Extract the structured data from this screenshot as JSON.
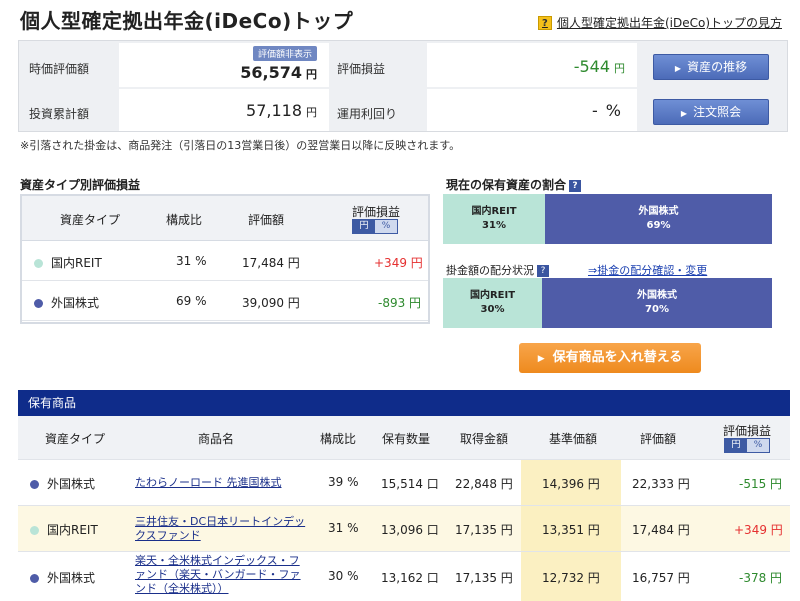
{
  "page": {
    "title": "個人型確定拠出年金(iDeCo)トップ",
    "help_link": "個人型確定拠出年金(iDeCo)トップの見方",
    "help_icon": "?"
  },
  "summary": {
    "valuation_label": "時価評価額",
    "valuation_badge": "評価額非表示",
    "valuation_value": "56,574",
    "yen": "円",
    "invest_label": "投資累計額",
    "invest_value": "57,118",
    "gain_label": "評価損益",
    "gain_value": "-544",
    "yield_label": "運用利回り",
    "yield_value": "-",
    "yield_unit": "%",
    "btn_trend": "資産の推移",
    "btn_orders": "注文照会",
    "arrow": "▶"
  },
  "note": "※引落された掛金は、商品発注（引落日の13営業日後）の翌営業日以降に反映されます。",
  "asset_type": {
    "title": "資産タイプ別評価損益",
    "headers": {
      "type": "資産タイプ",
      "ratio": "構成比",
      "value": "評価額",
      "gain": "評価損益",
      "toggle_yen": "円",
      "toggle_pct": "%"
    },
    "rows": [
      {
        "name": "国内REIT",
        "ratio": "31 %",
        "value": "17,484 円",
        "gain": "+349 円",
        "color": "#b9e4d7"
      },
      {
        "name": "外国株式",
        "ratio": "69 %",
        "value": "39,090 円",
        "gain": "-893 円",
        "color": "#4f5ca8"
      }
    ]
  },
  "allocation": {
    "current_title": "現在の保有資産の割合",
    "current": [
      {
        "name": "国内REIT",
        "pct": "31%",
        "share": 0.31
      },
      {
        "name": "外国株式",
        "pct": "69%",
        "share": 0.69
      }
    ],
    "contrib_title": "掛金額の配分状況",
    "contrib_link": "⇒掛金の配分確認・変更",
    "contrib": [
      {
        "name": "国内REIT",
        "pct": "30%",
        "share": 0.3
      },
      {
        "name": "外国株式",
        "pct": "70%",
        "share": 0.7
      }
    ],
    "q_icon": "?",
    "switch_btn": "保有商品を入れ替える"
  },
  "holdings": {
    "title": "保有商品",
    "headers": {
      "type": "資産タイプ",
      "name": "商品名",
      "ratio": "構成比",
      "qty": "保有数量",
      "cost": "取得金額",
      "base": "基準価額",
      "value": "評価額",
      "gain": "評価損益",
      "toggle_yen": "円",
      "toggle_pct": "%"
    },
    "rows": [
      {
        "type": "外国株式",
        "name": "たわらノーロード 先進国株式",
        "ratio": "39 %",
        "qty": "15,514 口",
        "cost": "22,848 円",
        "base": "14,396 円",
        "value": "22,333 円",
        "gain": "-515 円",
        "color": "#4f5ca8"
      },
      {
        "type": "国内REIT",
        "name": "三井住友・DC日本リートインデックスファンド",
        "ratio": "31 %",
        "qty": "13,096 口",
        "cost": "17,135 円",
        "base": "13,351 円",
        "value": "17,484 円",
        "gain": "+349 円",
        "color": "#b9e4d7"
      },
      {
        "type": "外国株式",
        "name": "楽天・全米株式インデックス・ファンド（楽天・バンガード・ファンド（全米株式））",
        "ratio": "30 %",
        "qty": "13,162 口",
        "cost": "17,135 円",
        "base": "12,732 円",
        "value": "16,757 円",
        "gain": "-378 円",
        "color": "#4f5ca8"
      }
    ]
  }
}
